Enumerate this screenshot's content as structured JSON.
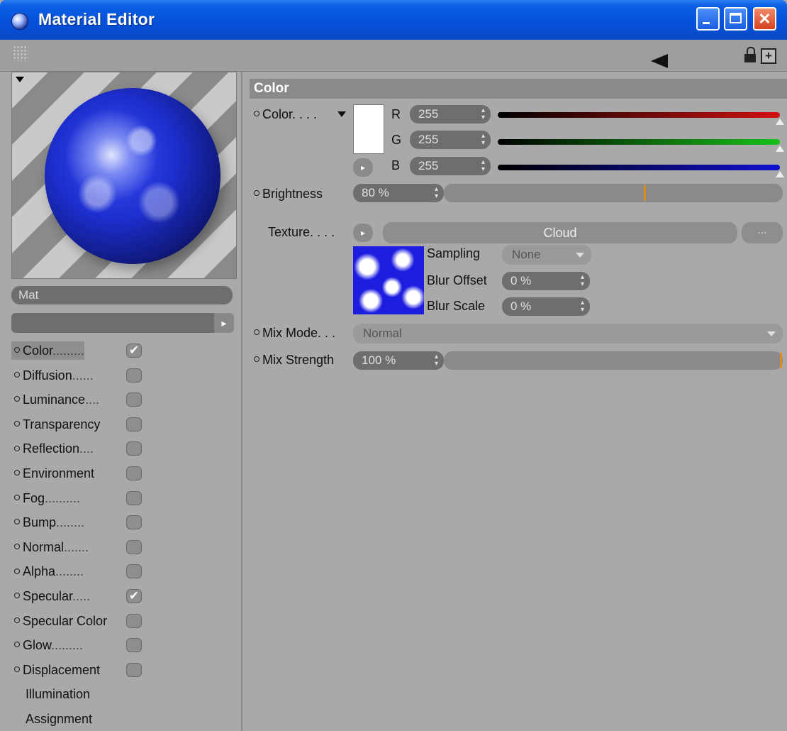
{
  "window": {
    "title": "Material Editor"
  },
  "preview": {
    "material_name": "Mat"
  },
  "channels": [
    {
      "label": "Color",
      "dots": ".........",
      "checked": true
    },
    {
      "label": "Diffusion",
      "dots": "......",
      "checked": false
    },
    {
      "label": "Luminance",
      "dots": "....",
      "checked": false
    },
    {
      "label": "Transparency",
      "dots": "",
      "checked": false
    },
    {
      "label": "Reflection",
      "dots": "....",
      "checked": false
    },
    {
      "label": "Environment",
      "dots": "",
      "checked": false
    },
    {
      "label": "Fog",
      "dots": "..........",
      "checked": false
    },
    {
      "label": "Bump",
      "dots": "........",
      "checked": false
    },
    {
      "label": "Normal",
      "dots": ".......",
      "checked": false
    },
    {
      "label": "Alpha",
      "dots": "........",
      "checked": false
    },
    {
      "label": "Specular",
      "dots": ".....",
      "checked": true
    },
    {
      "label": "Specular Color",
      "dots": "",
      "checked": false
    },
    {
      "label": "Glow",
      "dots": ".........",
      "checked": false
    },
    {
      "label": "Displacement",
      "dots": "",
      "checked": false
    }
  ],
  "extra_items": [
    "Illumination",
    "Assignment"
  ],
  "color_section": {
    "header": "Color",
    "color_label": "Color. . . .",
    "r_label": "R",
    "r_value": "255",
    "g_label": "G",
    "g_value": "255",
    "b_label": "B",
    "b_value": "255",
    "r_level": 1.0,
    "g_level": 1.0,
    "b_level": 1.0,
    "brightness_label": "Brightness",
    "brightness_value": "80 %",
    "brightness_level": 0.8,
    "texture_label": "Texture. . . .",
    "texture_name": "Cloud",
    "texture_more": "...",
    "sampling_label": "Sampling",
    "sampling_value": "None",
    "blur_offset_label": "Blur Offset",
    "blur_offset_value": "0 %",
    "blur_scale_label": "Blur Scale",
    "blur_scale_value": "0 %",
    "mix_mode_label": "Mix Mode. . .",
    "mix_mode_value": "Normal",
    "mix_strength_label": "Mix Strength",
    "mix_strength_value": "100 %",
    "mix_strength_level": 1.0
  },
  "colors": {
    "accent_marker": "#e08a1a",
    "title_bar": "#0450d8",
    "close": "#d8411e"
  }
}
